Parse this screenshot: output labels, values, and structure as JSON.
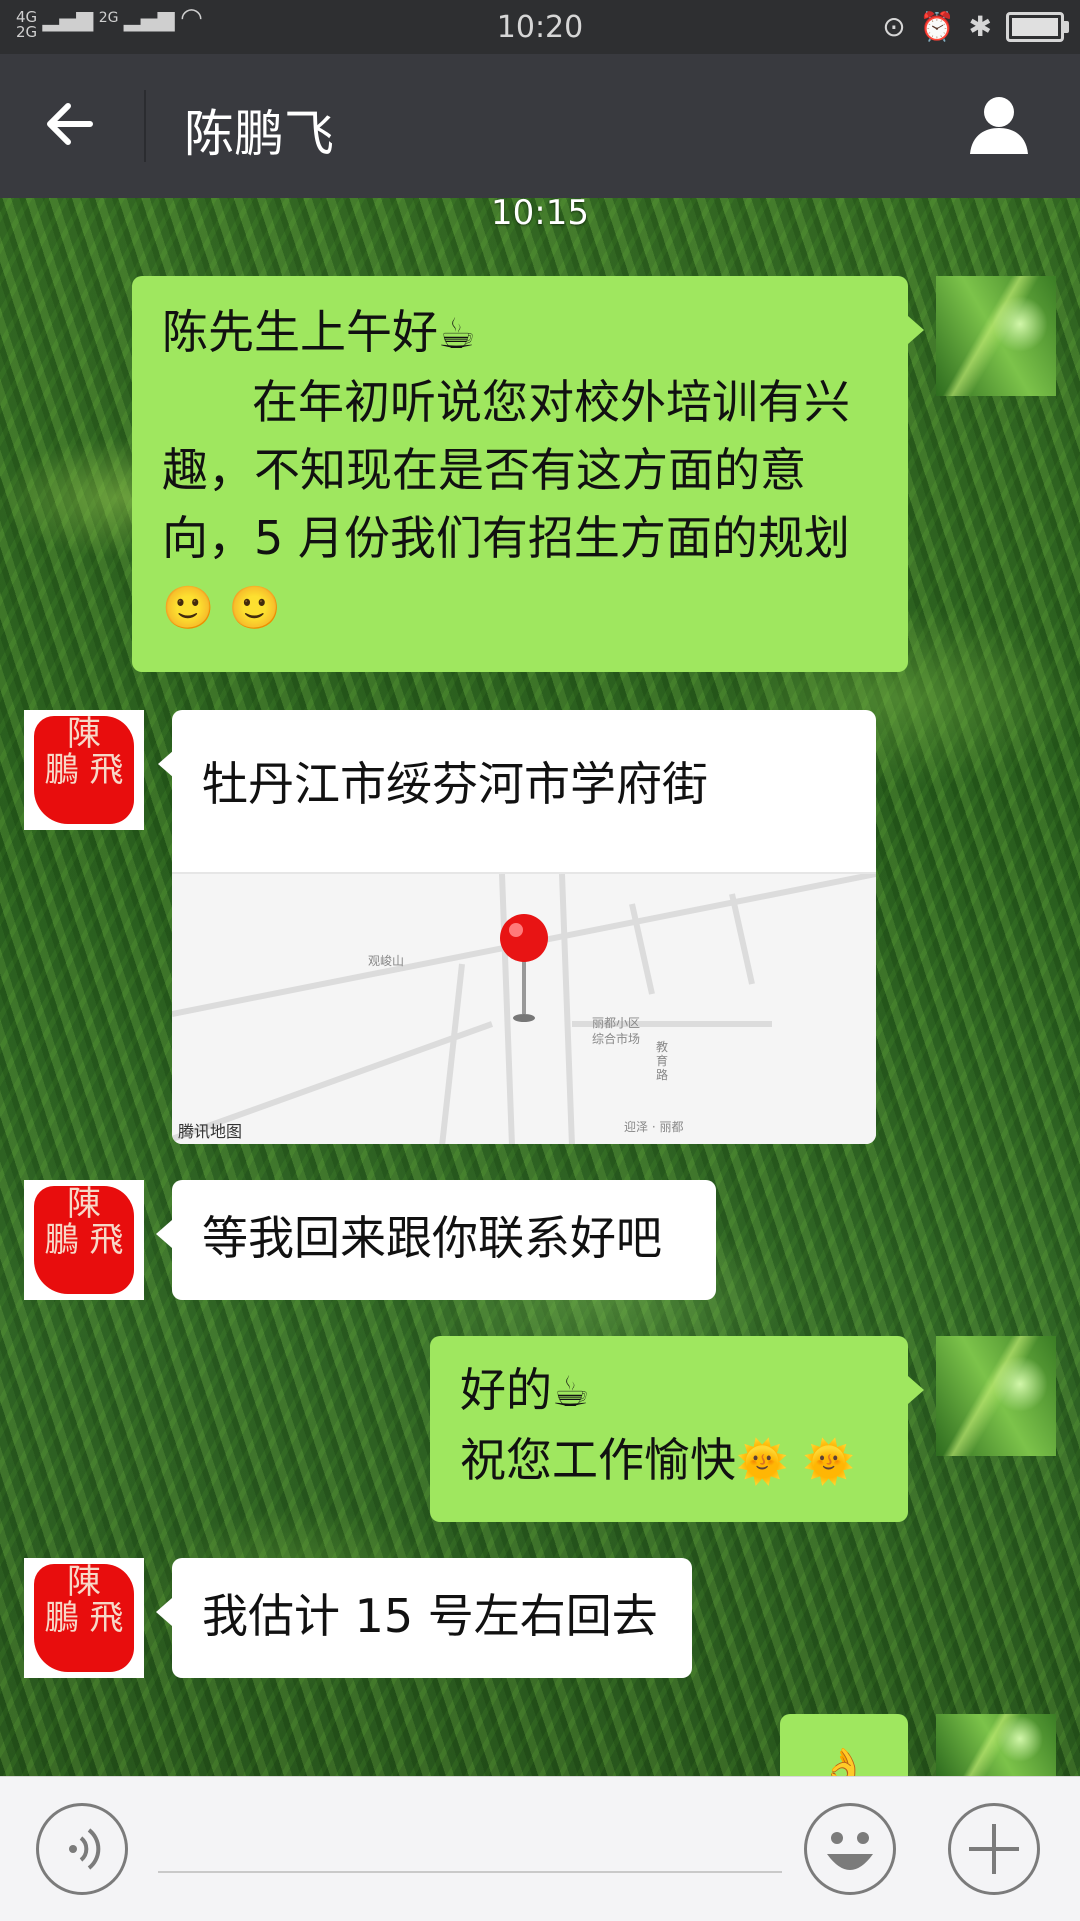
{
  "status_bar": {
    "network_top": "4G",
    "network_bottom": "2G",
    "network_2g": "2G",
    "time": "10:20"
  },
  "header": {
    "title": "陈鹏飞"
  },
  "chat": {
    "timestamp": "10:15",
    "messages": [
      {
        "sender": "self",
        "line1": "陈先生上午好",
        "line2": "在年初听说您对校外培训有兴",
        "line3": "趣，不知现在是否有这方面的意",
        "line4": "向，5 月份我们有招生方面的规划"
      },
      {
        "sender": "other",
        "type": "location",
        "title": "牡丹江市绥芬河市学府街",
        "map_labels": [
          "观峻山",
          "丽都小区",
          "综合市场",
          "教",
          "育",
          "路",
          "迎泽 · 丽都"
        ],
        "map_brand": "腾讯地图"
      },
      {
        "sender": "other",
        "text": "等我回来跟你联系好吧"
      },
      {
        "sender": "self",
        "line1": "好的",
        "line2": "祝您工作愉快"
      },
      {
        "sender": "other",
        "text": "我估计 15 号左右回去"
      }
    ]
  },
  "seal_text": [
    "陳",
    "鵬",
    "飛"
  ],
  "colors": {
    "header_bg": "#393a3f",
    "status_bg": "#2e2f31",
    "bubble_self": "#9fe75f",
    "bubble_other": "#ffffff",
    "seal_red": "#e80d0d"
  }
}
